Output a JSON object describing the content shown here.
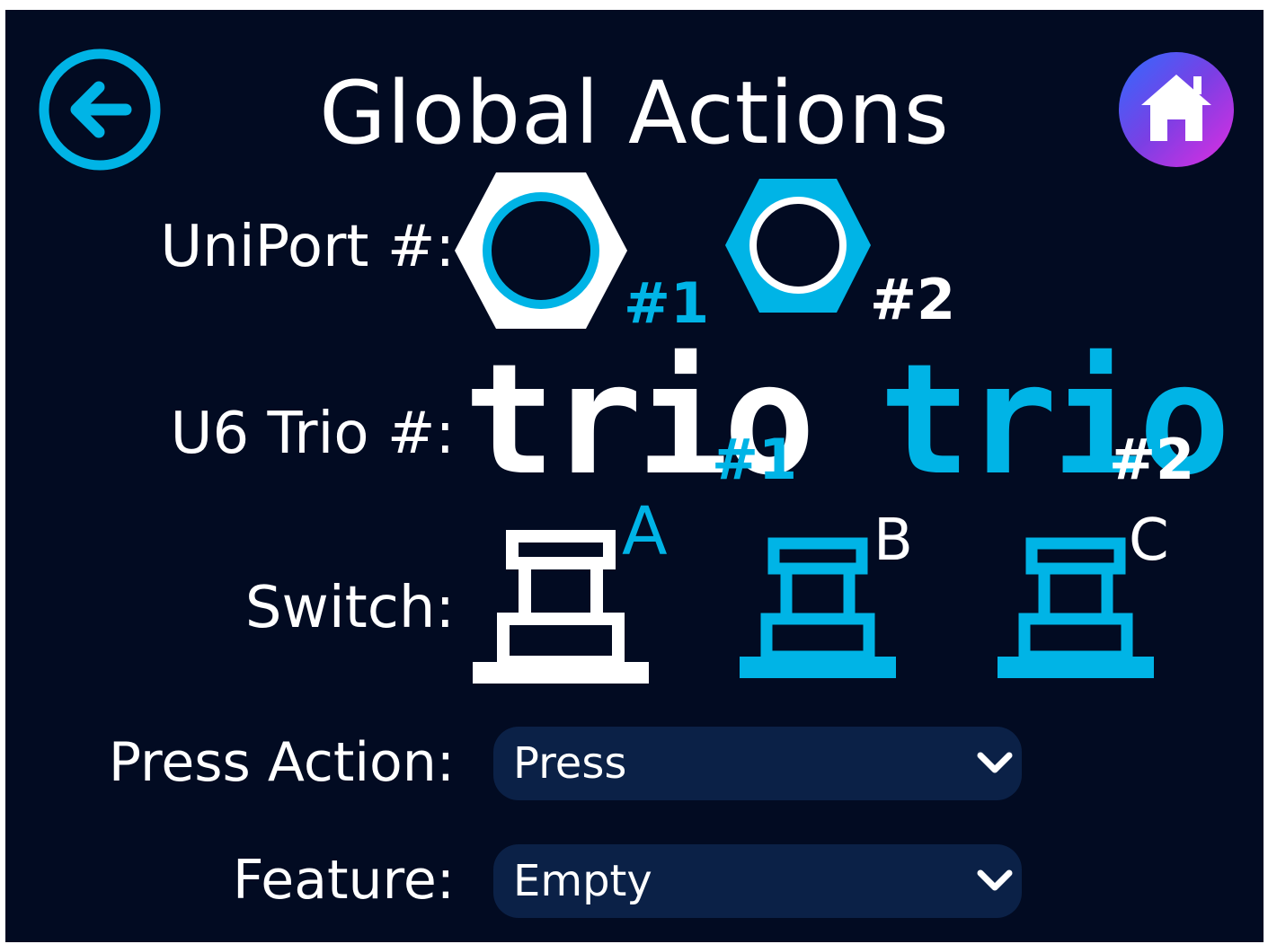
{
  "header": {
    "title": "Global Actions",
    "back_icon": "arrow-left-circle-icon",
    "home_icon": "home-icon"
  },
  "uniport": {
    "label": "UniPort #:",
    "options": [
      {
        "tag": "#1",
        "icon": "hex-nut-icon",
        "selected": true
      },
      {
        "tag": "#2",
        "icon": "hex-nut-icon",
        "selected": false
      }
    ]
  },
  "u6trio": {
    "label": "U6 Trio #:",
    "options": [
      {
        "word": "trio",
        "tag": "#1",
        "selected": true
      },
      {
        "word": "trio",
        "tag": "#2",
        "selected": false
      }
    ]
  },
  "switch": {
    "label": "Switch:",
    "options": [
      {
        "tag": "A",
        "icon": "footswitch-icon",
        "selected": true
      },
      {
        "tag": "B",
        "icon": "footswitch-icon",
        "selected": false
      },
      {
        "tag": "C",
        "icon": "footswitch-icon",
        "selected": false
      }
    ]
  },
  "press_action": {
    "label": "Press Action:",
    "value": "Press"
  },
  "feature": {
    "label": "Feature:",
    "value": "Empty"
  },
  "colors": {
    "background": "#020b22",
    "accent": "#00b4e6",
    "selected": "#ffffff",
    "dropdown": "#0b2147",
    "home_gradient": [
      "#7b3fe4",
      "#2f6bff",
      "#e02de0"
    ]
  }
}
